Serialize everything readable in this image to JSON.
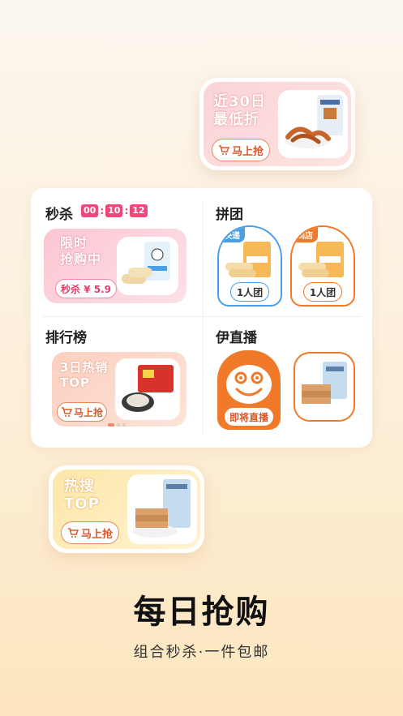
{
  "promo_top": {
    "title": "近30日\n最低折",
    "button": "马上抢"
  },
  "flash_sale": {
    "title": "秒杀",
    "timer": {
      "h": "00",
      "m": "10",
      "s": "12"
    },
    "card_title": "限时\n抢购中",
    "price_label": "秒杀 ¥ 5.9"
  },
  "group_buy": {
    "title": "拼团",
    "cards": [
      {
        "tag": "快递",
        "button": "1人团"
      },
      {
        "tag": "到店",
        "button": "1人团"
      }
    ]
  },
  "ranking": {
    "title": "排行榜",
    "card_title": "3日热销\nTOP",
    "button": "马上抢"
  },
  "live": {
    "title": "伊直播",
    "button": "即将直播"
  },
  "promo_bottom": {
    "title": "热搜\nTOP",
    "button": "马上抢"
  },
  "brand": {
    "name": "每日抢购",
    "slogan": "组合秒杀·一件包邮"
  },
  "colors": {
    "accent_orange": "#f07a2a",
    "flash_pink": "#f0477a",
    "group_blue": "#4a9ee8"
  }
}
